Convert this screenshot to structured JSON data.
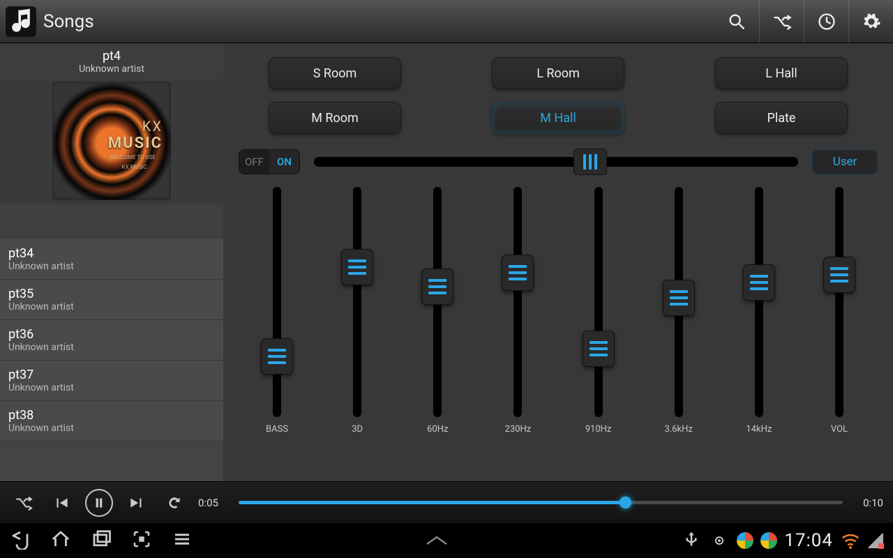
{
  "header": {
    "title": "Songs"
  },
  "now_playing": {
    "title": "pt4",
    "artist": "Unknown artist",
    "cover": {
      "line1": "KX",
      "line2": "MUSIC",
      "sub1": "WELCOME TO USE",
      "sub2": "KX MUSIC"
    }
  },
  "songs": [
    {
      "title": "pt34",
      "artist": "Unknown artist"
    },
    {
      "title": "pt35",
      "artist": "Unknown artist"
    },
    {
      "title": "pt36",
      "artist": "Unknown artist"
    },
    {
      "title": "pt37",
      "artist": "Unknown artist"
    },
    {
      "title": "pt38",
      "artist": "Unknown artist"
    }
  ],
  "presets": [
    {
      "label": "S Room",
      "selected": false
    },
    {
      "label": "L Room",
      "selected": false
    },
    {
      "label": "L Hall",
      "selected": false
    },
    {
      "label": "M Room",
      "selected": false
    },
    {
      "label": "M Hall",
      "selected": true
    },
    {
      "label": "Plate",
      "selected": false
    }
  ],
  "toggle": {
    "off": "OFF",
    "on": "ON",
    "state": "on"
  },
  "master_slider_pct": 57,
  "user_label": "User",
  "bands": [
    {
      "label": "BASS",
      "value": 22
    },
    {
      "label": "3D",
      "value": 68
    },
    {
      "label": "60Hz",
      "value": 58
    },
    {
      "label": "230Hz",
      "value": 65
    },
    {
      "label": "910Hz",
      "value": 26
    },
    {
      "label": "3.6kHz",
      "value": 52
    },
    {
      "label": "14kHz",
      "value": 60
    },
    {
      "label": "VOL",
      "value": 64
    }
  ],
  "playback": {
    "elapsed": "0:05",
    "total": "0:10",
    "progress_pct": 64
  },
  "status_bar": {
    "time": "17:04"
  }
}
